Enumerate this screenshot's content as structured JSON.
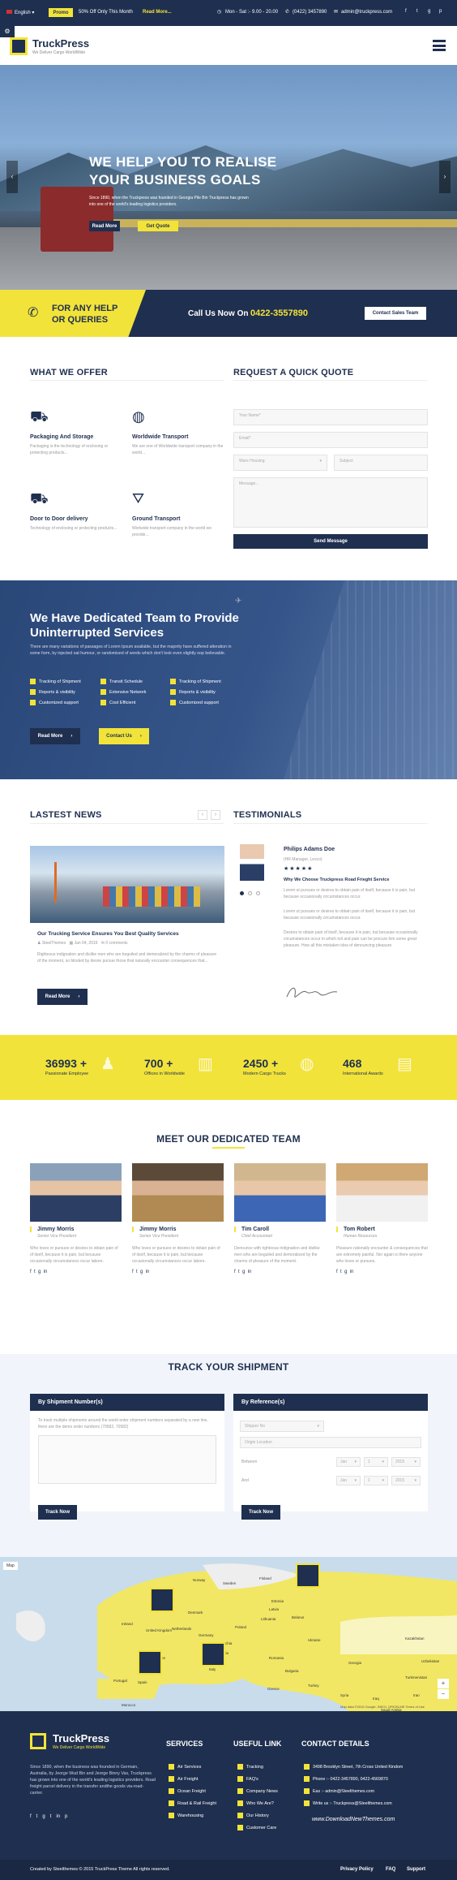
{
  "topbar": {
    "language": "English",
    "promo_badge": "Promo",
    "promo_text": "50% Off Only This Month",
    "promo_link": "Read More...",
    "hours": "Mon - Sat :- 9.00 - 20.00",
    "phone": "(0422) 3457890",
    "email": "admin@truckpress.com"
  },
  "header": {
    "brand": "TruckPress",
    "tagline": "We Deliver Cargo WorldWide"
  },
  "hero": {
    "line1": "WE HELP YOU TO REALISE",
    "line2": "YOUR BUSINESS GOALS",
    "desc": "Since 1890, when the Truckpress was founded in Georgia Pile Bin Truckpress has grown into one of the world's leading logistics providers.",
    "btn_read": "Read More",
    "btn_quote": "Get Quote"
  },
  "callbar": {
    "help1": "FOR ANY HELP",
    "help2": "OR QUERIES",
    "call_label": "Call Us Now On",
    "call_number": "0422-3557890",
    "contact_btn": "Contact Sales Team"
  },
  "offer": {
    "title": "WHAT WE OFFER",
    "items": [
      {
        "name": "Packaging And Storage",
        "desc": "Packaging is the technology of enclosing or protecting products..."
      },
      {
        "name": "Worldwide Transport",
        "desc": "We are one of Worldwide transport company in the world..."
      },
      {
        "name": "Door to Door delivery",
        "desc": "Technology of enclosing or protecting products..."
      },
      {
        "name": "Ground Transport",
        "desc": "Worlwide transport company in the world we provide..."
      }
    ]
  },
  "quote": {
    "title": "REQUEST A QUICK QUOTE",
    "name_ph": "Your Name*",
    "email_ph": "Email*",
    "select_value": "Ware Housing",
    "subject_ph": "Subject",
    "message_ph": "Message...",
    "send_btn": "Send Message"
  },
  "team_banner": {
    "title1": "We Have Dedicated Team to Provide",
    "title2": "Uninterrupted Services",
    "desc": "There are many variations of passages of Lorem Ipsum available, but the majority have suffered alteration in some form, by injected oat humour, or randomised of words which don't look even slightly oop believable.",
    "checks": [
      "Tracking of Shipment",
      "Transit Schedule",
      "Tracking of Shipment",
      "Reports & visibility",
      "Extensive Network",
      "Reports & visibility",
      "Customized support",
      "Cost Efficient",
      "Customized support"
    ],
    "btn_read": "Read More",
    "btn_contact": "Contact Us"
  },
  "news": {
    "title": "LASTEST NEWS",
    "post_title": "Our Trucking Service Ensures You Best Quality Services",
    "author": "SteelThemes",
    "date": "Jan 04, 2016",
    "comments": "0 comments",
    "excerpt": "Righteous indignation and dislike men who are beguiled and demoralized by the charms of pleasure of the moment, so blinded by desire pursue those that naturally encounter consequences that...",
    "read_btn": "Read More"
  },
  "testimonials": {
    "title": "TESTIMONIALS",
    "name": "Philips Adams Doe",
    "role": "(HR Manager, Lexco)",
    "stars": "★★★★★",
    "quote_title": "Why We Choose Truckpress Road Frieght Service",
    "p1": "Lorem ut pursues or desires to obtain pain of itself, because it is pain, but because occasionally circumstances occur.",
    "p2": "Lorem ut pursues or desires to obtain pain of itself, because it is pain, but because occasionally circumstances occur.",
    "p3": "Desires to obtain pain of itself, because it is pain, but because occasionally circumstances occur in which toil and pain can be procure him some great pleasure. How all this mistaken idea of denouncing pleasure."
  },
  "stats": [
    {
      "value": "36993 +",
      "label": "Passionate Employee"
    },
    {
      "value": "700 +",
      "label": "Offices in Worldwide"
    },
    {
      "value": "2450 +",
      "label": "Modern Cargo Trucks"
    },
    {
      "value": "468",
      "label": "International Awards"
    }
  ],
  "team": {
    "title": "MEET OUR DEDICATED TEAM",
    "members": [
      {
        "name": "Jimmy Morris",
        "role": "Senior Vice President",
        "bio": "Who loves or pursues or desires to obtain pain of of itself, because it is pain, but because occasionally circumstances occur labore."
      },
      {
        "name": "Jimmy Morris",
        "role": "Senior Vice President",
        "bio": "Who loves or pursues or desires to obtain pain of of itself, because it is pain, but because occasionally circumstances occur labore."
      },
      {
        "name": "Tim Caroll",
        "role": "Chief Accountant",
        "bio": "Denounce with righteous indignation and dislike men who are beguiled and demoralized by the charms of pleasure of the moment."
      },
      {
        "name": "Tom Robert",
        "role": "Human Resources",
        "bio": "Pleasure rationally encounter & consequences that are extremely painful. Nor again is there anyone who loves or pursues."
      }
    ]
  },
  "track": {
    "title": "TRACK YOUR SHIPMENT",
    "by_number": "By Shipment Number(s)",
    "by_reference": "By Reference(s)",
    "help": "To track multiple shipments around the world enter shipment numbers separated by a new line, there are the demo order numbers (70582, 70582)",
    "shipper_ph": "Shipper No",
    "origin_ph": "Origin Location",
    "between": "Between",
    "and": "And",
    "month1": "Jan",
    "day1": "1",
    "year1": "2015",
    "month2": "Jan",
    "day2": "1",
    "year2": "2015",
    "btn1": "Track Now",
    "btn2": "Track Now"
  },
  "map": {
    "map_btn": "Map",
    "labels": [
      "Norway",
      "Sweden",
      "Finland",
      "Estonia",
      "Latvia",
      "Denmark",
      "Lithuania",
      "Belarus",
      "Ireland",
      "United Kingdom",
      "Netherlands",
      "Poland",
      "Germany",
      "Czechia",
      "Ukraine",
      "France",
      "Austria",
      "Romania",
      "Italy",
      "Bulgaria",
      "Portugal",
      "Spain",
      "Greece",
      "Turkey",
      "Morocco",
      "Kazakhstan",
      "Georgia",
      "Syria",
      "Iraq",
      "Iran",
      "Uzbekistan",
      "Turkmenistan",
      "Saudi Arabia"
    ],
    "footnote": "Map data ©2016 Google, INEGI, ORION-ME  Terms of Use"
  },
  "footer": {
    "brand": "TruckPress",
    "tagline": "We Deliver Cargo WorldWide",
    "about": "Since 1890, when the business was founded in Germain, Australia, by Jeorge Wud Bin and Jeorge Binny Vas, Truckpress has grown into one of the world's leading logistics providers. Road freight parcel delivery in the transfer andthe goods via-road-carrier.",
    "services_title": "SERVICES",
    "services": [
      "Air Services",
      "Air Freight",
      "Ocean Freight",
      "Road & Rail Freight",
      "Warehousing"
    ],
    "useful_title": "USEFUL LINK",
    "useful": [
      "Tracking",
      "FAQ's",
      "Company News",
      "Who We Are?",
      "Our History",
      "Customer Care"
    ],
    "contact_title": "CONTACT DETAILS",
    "address": "3498 Brooklyn Street, 7th Cross United Kindom",
    "phone": "Phone :- 0422-3457890, 0422-4569870",
    "email": "Eas :- admin@Steelthemes.com",
    "write": "Write us :- Truckpress@Steelthemes.com",
    "watermark": "www.DownloadNewThemes.com",
    "copyright": "Created by Steelthemes © 2015 TruckPress Theme All rights reserved.",
    "links": [
      "Privacy Policy",
      "FAQ",
      "Support"
    ]
  },
  "colors": {
    "navy": "#1f2f4f",
    "yellow": "#f2e33a"
  }
}
